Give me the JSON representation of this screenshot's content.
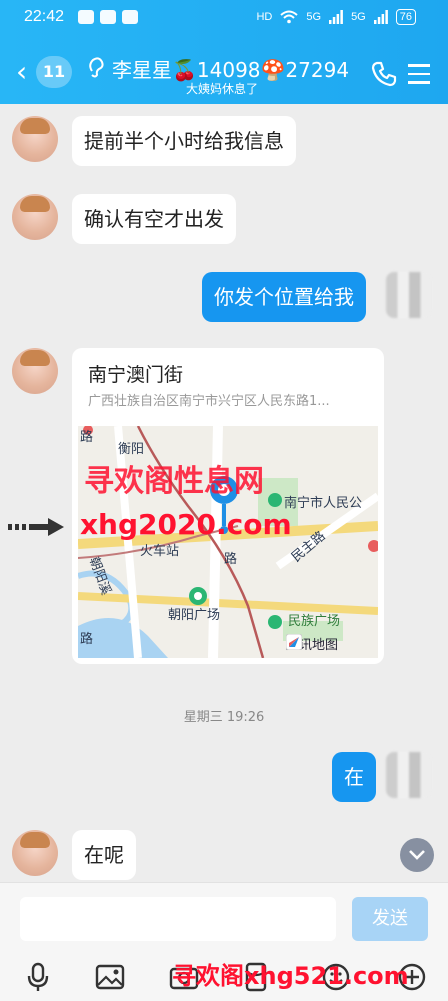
{
  "status_bar": {
    "time": "22:42",
    "battery": "76",
    "signal_labels": [
      "HD",
      "5G",
      "5G"
    ]
  },
  "header": {
    "back_badge": "11",
    "contact_name": "李星星🍒14098🍄27294",
    "subtitle": "大姨妈休息了"
  },
  "messages": [
    {
      "from": "other",
      "text": "提前半个小时给我信息"
    },
    {
      "from": "other",
      "text": "确认有空才出发"
    },
    {
      "from": "me",
      "text": "你发个位置给我"
    }
  ],
  "location_card": {
    "title": "南宁澳门街",
    "address": "广西壮族自治区南宁市兴宁区人民东路1...",
    "map_labels": {
      "l1": "衡阳",
      "l2": "南宁市人民公",
      "l3": "火车站",
      "l4": "民主路",
      "l5": "朝阳溪",
      "l6": "朝阳广场",
      "l7": "民族广场",
      "l8": "路",
      "l9": "路",
      "l10": "路"
    },
    "map_logo": "腾讯地图"
  },
  "time_divider": "星期三 19:26",
  "later_messages": [
    {
      "from": "me",
      "text": "在"
    },
    {
      "from": "other",
      "text": "在呢"
    }
  ],
  "input_bar": {
    "send_label": "发送"
  },
  "watermarks": {
    "w1": "寻欢阁性息网",
    "w2": "xhg2020.com",
    "w3": "寻欢阁xhg521.com"
  },
  "colors": {
    "header": "#1ea7f0",
    "my_bubble": "#1696f0",
    "send_button": "#a8d4f6",
    "watermark": "#ff1230"
  }
}
